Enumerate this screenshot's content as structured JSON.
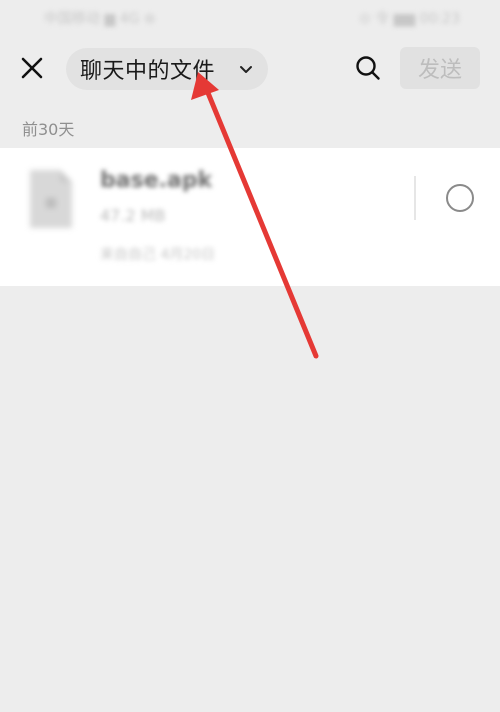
{
  "status_bar": {
    "left": "中国移动 ▆ 4G ⊜",
    "right": "⊙ 令 ▆▆ 00:23"
  },
  "header": {
    "title": "聊天中的文件",
    "send_label": "发送",
    "icons": {
      "close": "close-icon",
      "dropdown": "chevron-down-icon",
      "search": "search-icon"
    }
  },
  "section": {
    "label": "前30天"
  },
  "file": {
    "name": "base.apk",
    "size": "47.2 MB",
    "meta": "来自自己 4月20日",
    "icon": "apk-file-icon"
  },
  "annotation": {
    "color": "#e53935"
  }
}
